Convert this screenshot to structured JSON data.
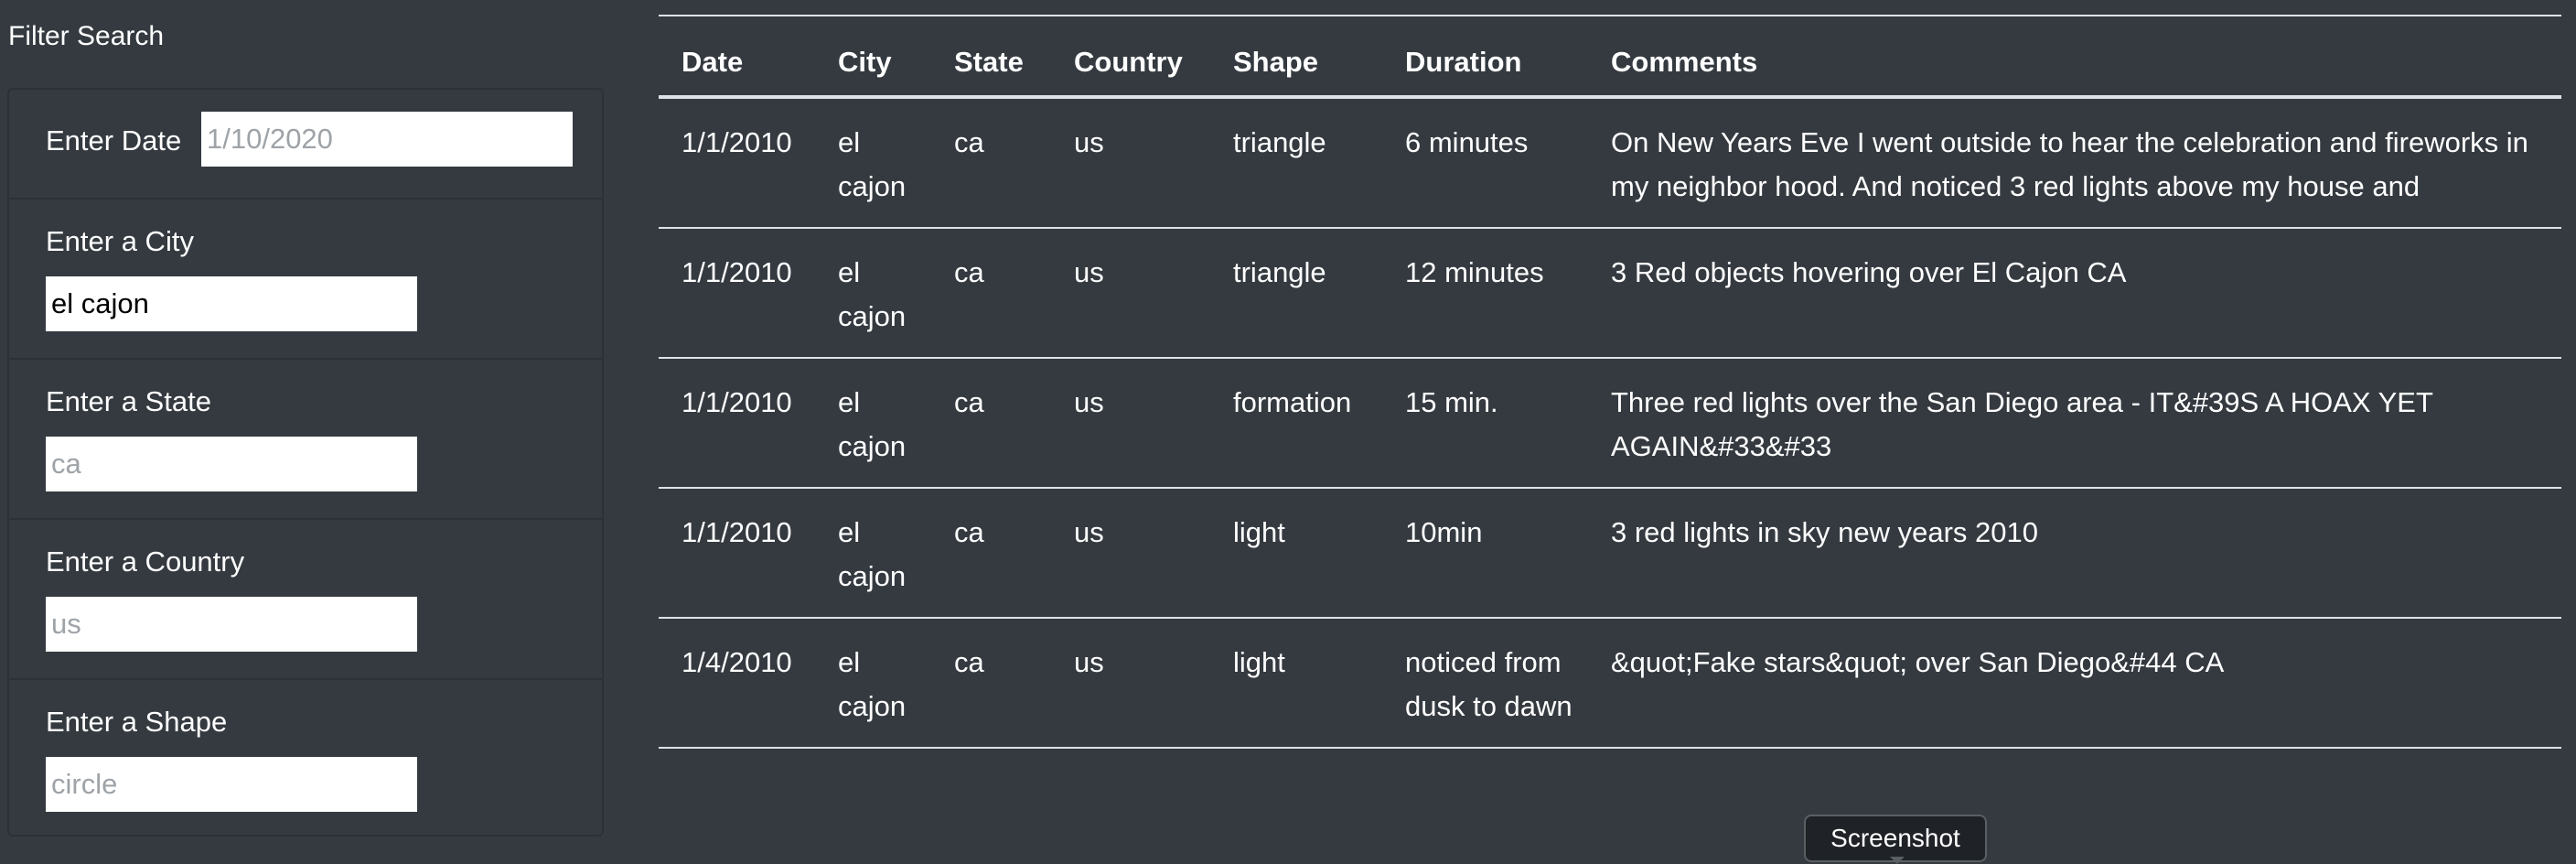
{
  "filter": {
    "title": "Filter Search",
    "date": {
      "label": "Enter Date",
      "placeholder": "1/10/2020",
      "value": ""
    },
    "city": {
      "label": "Enter a City",
      "placeholder": "",
      "value": "el cajon"
    },
    "state": {
      "label": "Enter a State",
      "placeholder": "ca",
      "value": ""
    },
    "country": {
      "label": "Enter a Country",
      "placeholder": "us",
      "value": ""
    },
    "shape": {
      "label": "Enter a Shape",
      "placeholder": "circle",
      "value": ""
    }
  },
  "table": {
    "headers": [
      "Date",
      "City",
      "State",
      "Country",
      "Shape",
      "Duration",
      "Comments"
    ],
    "rows": [
      [
        "1/1/2010",
        "el cajon",
        "ca",
        "us",
        "triangle",
        "6 minutes",
        "On New Years Eve I went outside to hear the celebration and fireworks in my neighbor hood. And noticed 3 red lights above my house and"
      ],
      [
        "1/1/2010",
        "el cajon",
        "ca",
        "us",
        "triangle",
        "12 minutes",
        "3 Red objects hovering over El Cajon CA"
      ],
      [
        "1/1/2010",
        "el cajon",
        "ca",
        "us",
        "formation",
        "15 min.",
        "Three red lights over the San Diego area - IT&#39S A HOAX YET AGAIN&#33&#33"
      ],
      [
        "1/1/2010",
        "el cajon",
        "ca",
        "us",
        "light",
        "10min",
        "3 red lights in sky new years 2010"
      ],
      [
        "1/4/2010",
        "el cajon",
        "ca",
        "us",
        "light",
        "noticed from dusk to dawn",
        "&quot;Fake stars&quot; over San Diego&#44 CA"
      ]
    ]
  },
  "tooltip": {
    "label": "Screenshot"
  }
}
